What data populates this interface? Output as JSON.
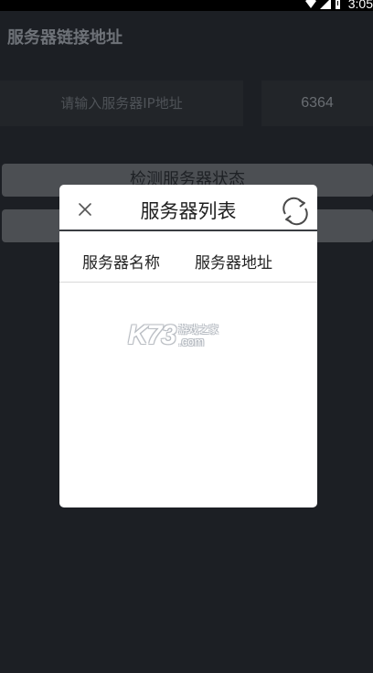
{
  "status_bar": {
    "time": "3:05",
    "icons": [
      "wifi-icon",
      "signal-icon",
      "battery-icon"
    ]
  },
  "page": {
    "title": "服务器链接地址",
    "ip_input": {
      "placeholder": "请输入服务器IP地址",
      "value": ""
    },
    "port_input": {
      "value": "6364"
    },
    "check_button_label": "检测服务器状态",
    "second_button_label": ""
  },
  "dialog": {
    "title": "服务器列表",
    "close_icon": "close-icon",
    "refresh_icon": "refresh-icon",
    "columns": [
      "服务器名称",
      "服务器地址"
    ],
    "rows": []
  },
  "watermark": {
    "logo": "K73",
    "cn": "游戏之家",
    "domain": ".com"
  },
  "colors": {
    "background": "#1c1f24",
    "dialog": "#ffffff",
    "button": "#4c4f53",
    "header_divider": "#3a3d42"
  }
}
